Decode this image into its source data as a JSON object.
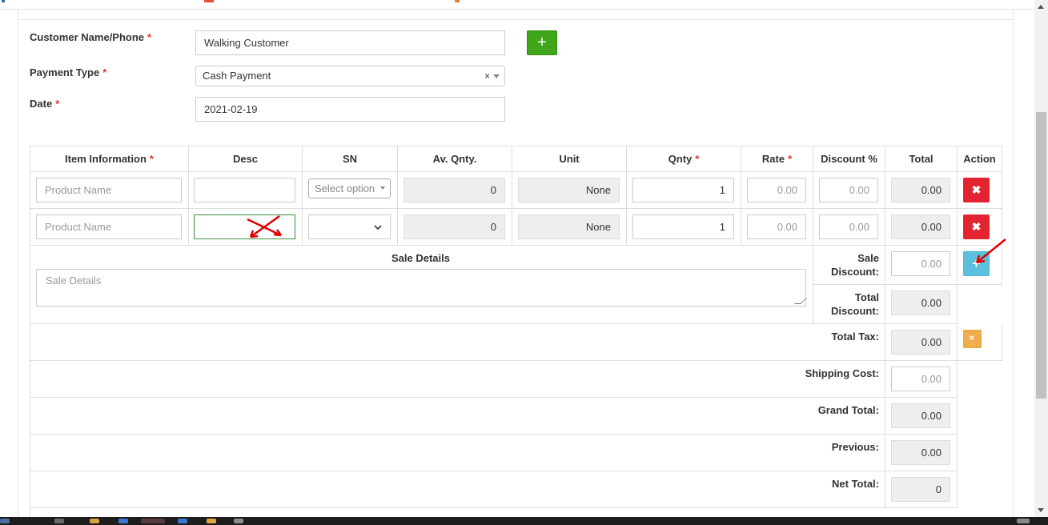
{
  "form": {
    "customer_label": "Customer Name/Phone",
    "customer_value": "Walking Customer",
    "payment_label": "Payment Type",
    "payment_value": "Cash Payment",
    "payment_clear": "×",
    "date_label": "Date",
    "date_value": "2021-02-19",
    "required_mark": "*",
    "add_customer": "+"
  },
  "table": {
    "headers": {
      "item": "Item Information",
      "desc": "Desc",
      "sn": "SN",
      "av_qnty": "Av. Qnty.",
      "unit": "Unit",
      "qnty": "Qnty",
      "rate": "Rate",
      "discount": "Discount %",
      "total": "Total",
      "action": "Action"
    },
    "rows": [
      {
        "product_placeholder": "Product Name",
        "desc": "",
        "sn_placeholder": "Select option",
        "av_qnty": "0",
        "unit": "None",
        "qnty": "1",
        "rate_placeholder": "0.00",
        "discount_placeholder": "0.00",
        "total": "0.00",
        "delete": "✖"
      },
      {
        "product_placeholder": "Product Name",
        "desc": "",
        "sn": "",
        "av_qnty": "0",
        "unit": "None",
        "qnty": "1",
        "rate_placeholder": "0.00",
        "discount_placeholder": "0.00",
        "total": "0.00",
        "delete": "✖"
      }
    ]
  },
  "details": {
    "title": "Sale Details",
    "placeholder": "Sale Details"
  },
  "summary": {
    "sale_discount_label_1": "Sale",
    "sale_discount_label_2": "Discount:",
    "sale_discount_placeholder": "0.00",
    "add_row": "+",
    "total_discount_label_1": "Total",
    "total_discount_label_2": "Discount:",
    "total_discount_value": "0.00",
    "total_tax_label": "Total Tax:",
    "total_tax_value": "0.00",
    "tax_toggle": "»",
    "shipping_label": "Shipping Cost:",
    "shipping_placeholder": "0.00",
    "grand_total_label": "Grand Total:",
    "grand_total_value": "0.00",
    "previous_label": "Previous:",
    "previous_value": "0.00",
    "net_total_label": "Net Total:",
    "net_total_value": "0"
  },
  "colors": {
    "required": "#e3342f",
    "add_green": "#3fa519",
    "delete_red": "#e3232f",
    "info_blue": "#5bc0de",
    "warning_orange": "#f0ad4e",
    "annotation_red": "#e00000"
  }
}
